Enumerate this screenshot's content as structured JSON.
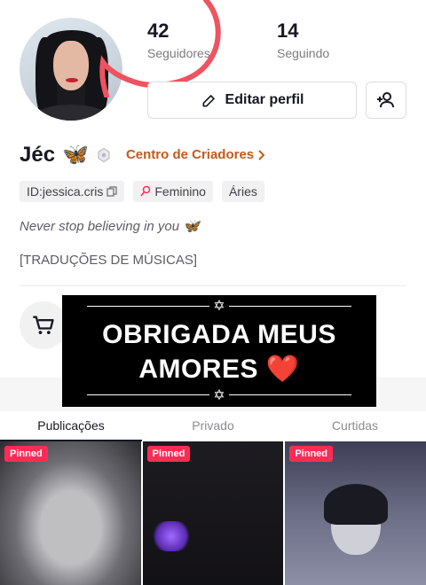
{
  "profile": {
    "followers_count": "42",
    "followers_label": "Seguidores",
    "following_count": "14",
    "following_label": "Seguindo",
    "edit_profile_label": "Editar perfil",
    "name": "Jéc",
    "name_emoji": "🦋",
    "creator_center_label": "Centro de Criadores",
    "tags": {
      "id": "ID:jessica.cris",
      "gender": "Feminino",
      "sign": "Áries"
    },
    "bio_line1": "Never stop believing in you 🦋",
    "bio_line2": "[TRADUÇÕES DE MÚSICAS]"
  },
  "overlay": {
    "line1": "OBRIGADA MEUS",
    "line2": "AMORES ❤️",
    "star_glyph": "✡"
  },
  "tabs": [
    "Publicações",
    "Privado",
    "Curtidas"
  ],
  "grid": {
    "pinned_label": "Pinned"
  },
  "colors": {
    "creator_accent": "#c45a1c",
    "pinned_badge": "#fe2c55",
    "scribble": "#f0525f"
  },
  "icons": [
    "pencil-icon",
    "add-user-icon",
    "butterfly-emoji",
    "badge-icon",
    "chevron-right-icon",
    "copy-icon",
    "female-icon",
    "cart-icon",
    "star-of-david-icon"
  ]
}
